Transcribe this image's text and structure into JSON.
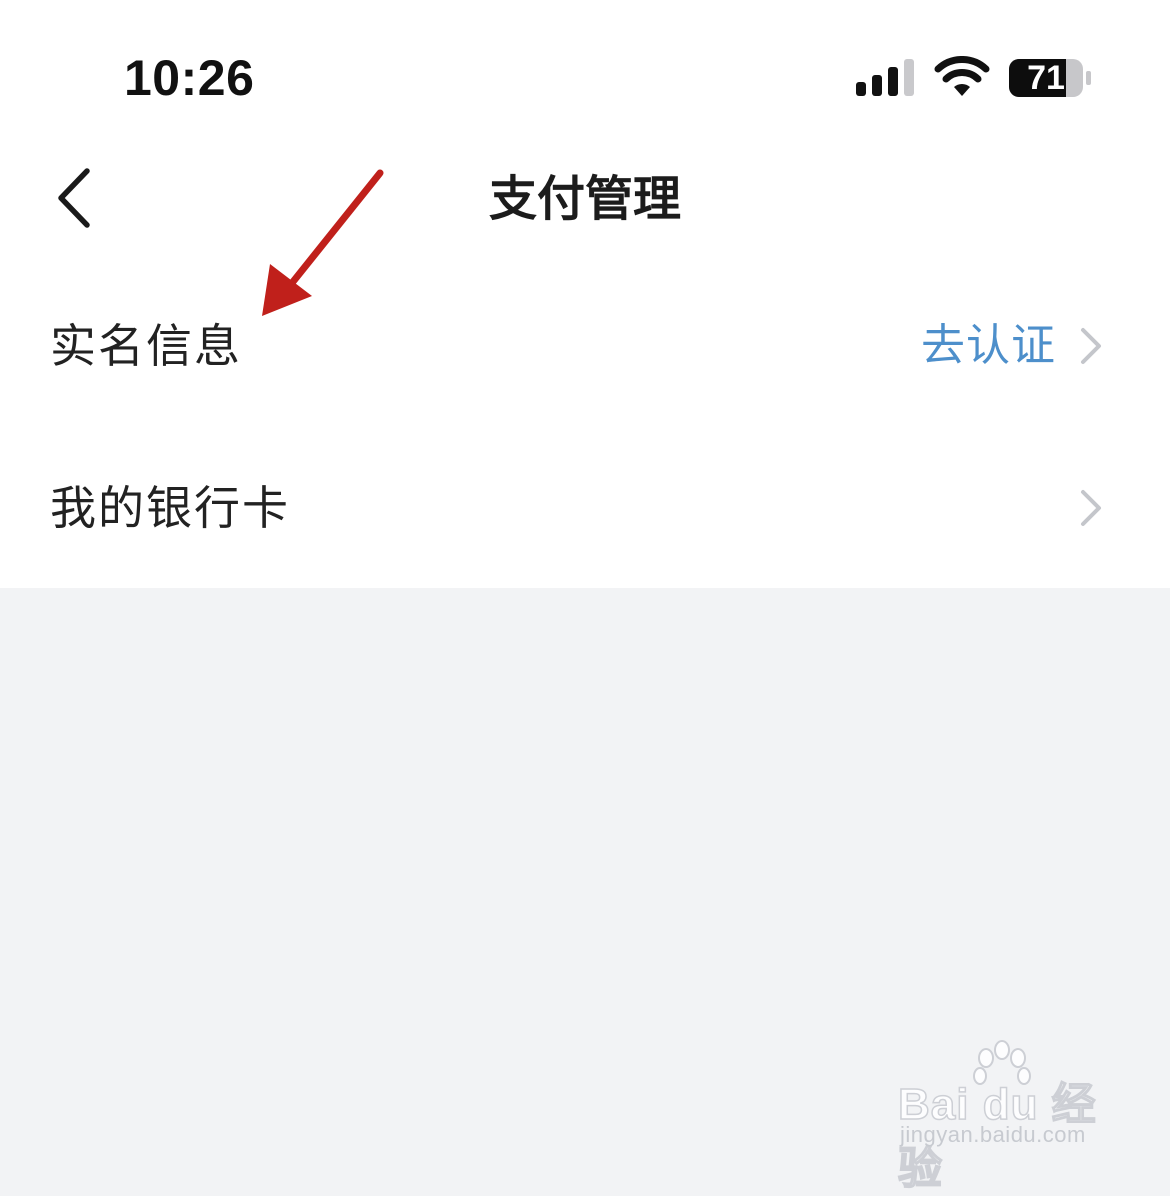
{
  "status_bar": {
    "time": "10:26",
    "battery_level": "71",
    "icons": [
      "signal-icon",
      "wifi-icon",
      "battery-icon"
    ]
  },
  "nav": {
    "back_icon": "chevron-left-icon",
    "title": "支付管理"
  },
  "list": {
    "items": [
      {
        "label": "实名信息",
        "value": "去认证",
        "icon": "chevron-right-icon"
      },
      {
        "label": "我的银行卡",
        "value": "",
        "icon": "chevron-right-icon"
      }
    ]
  },
  "annotation": {
    "icon": "red-arrow-icon",
    "color": "#c0201b"
  },
  "watermark": {
    "brand": "Bai  du 经验",
    "url": "jingyan.baidu.com"
  },
  "colors": {
    "accent": "#4d8fcb",
    "background": "#f2f3f5",
    "surface": "#ffffff",
    "text": "#222222",
    "chevron": "#c4c6cb"
  }
}
